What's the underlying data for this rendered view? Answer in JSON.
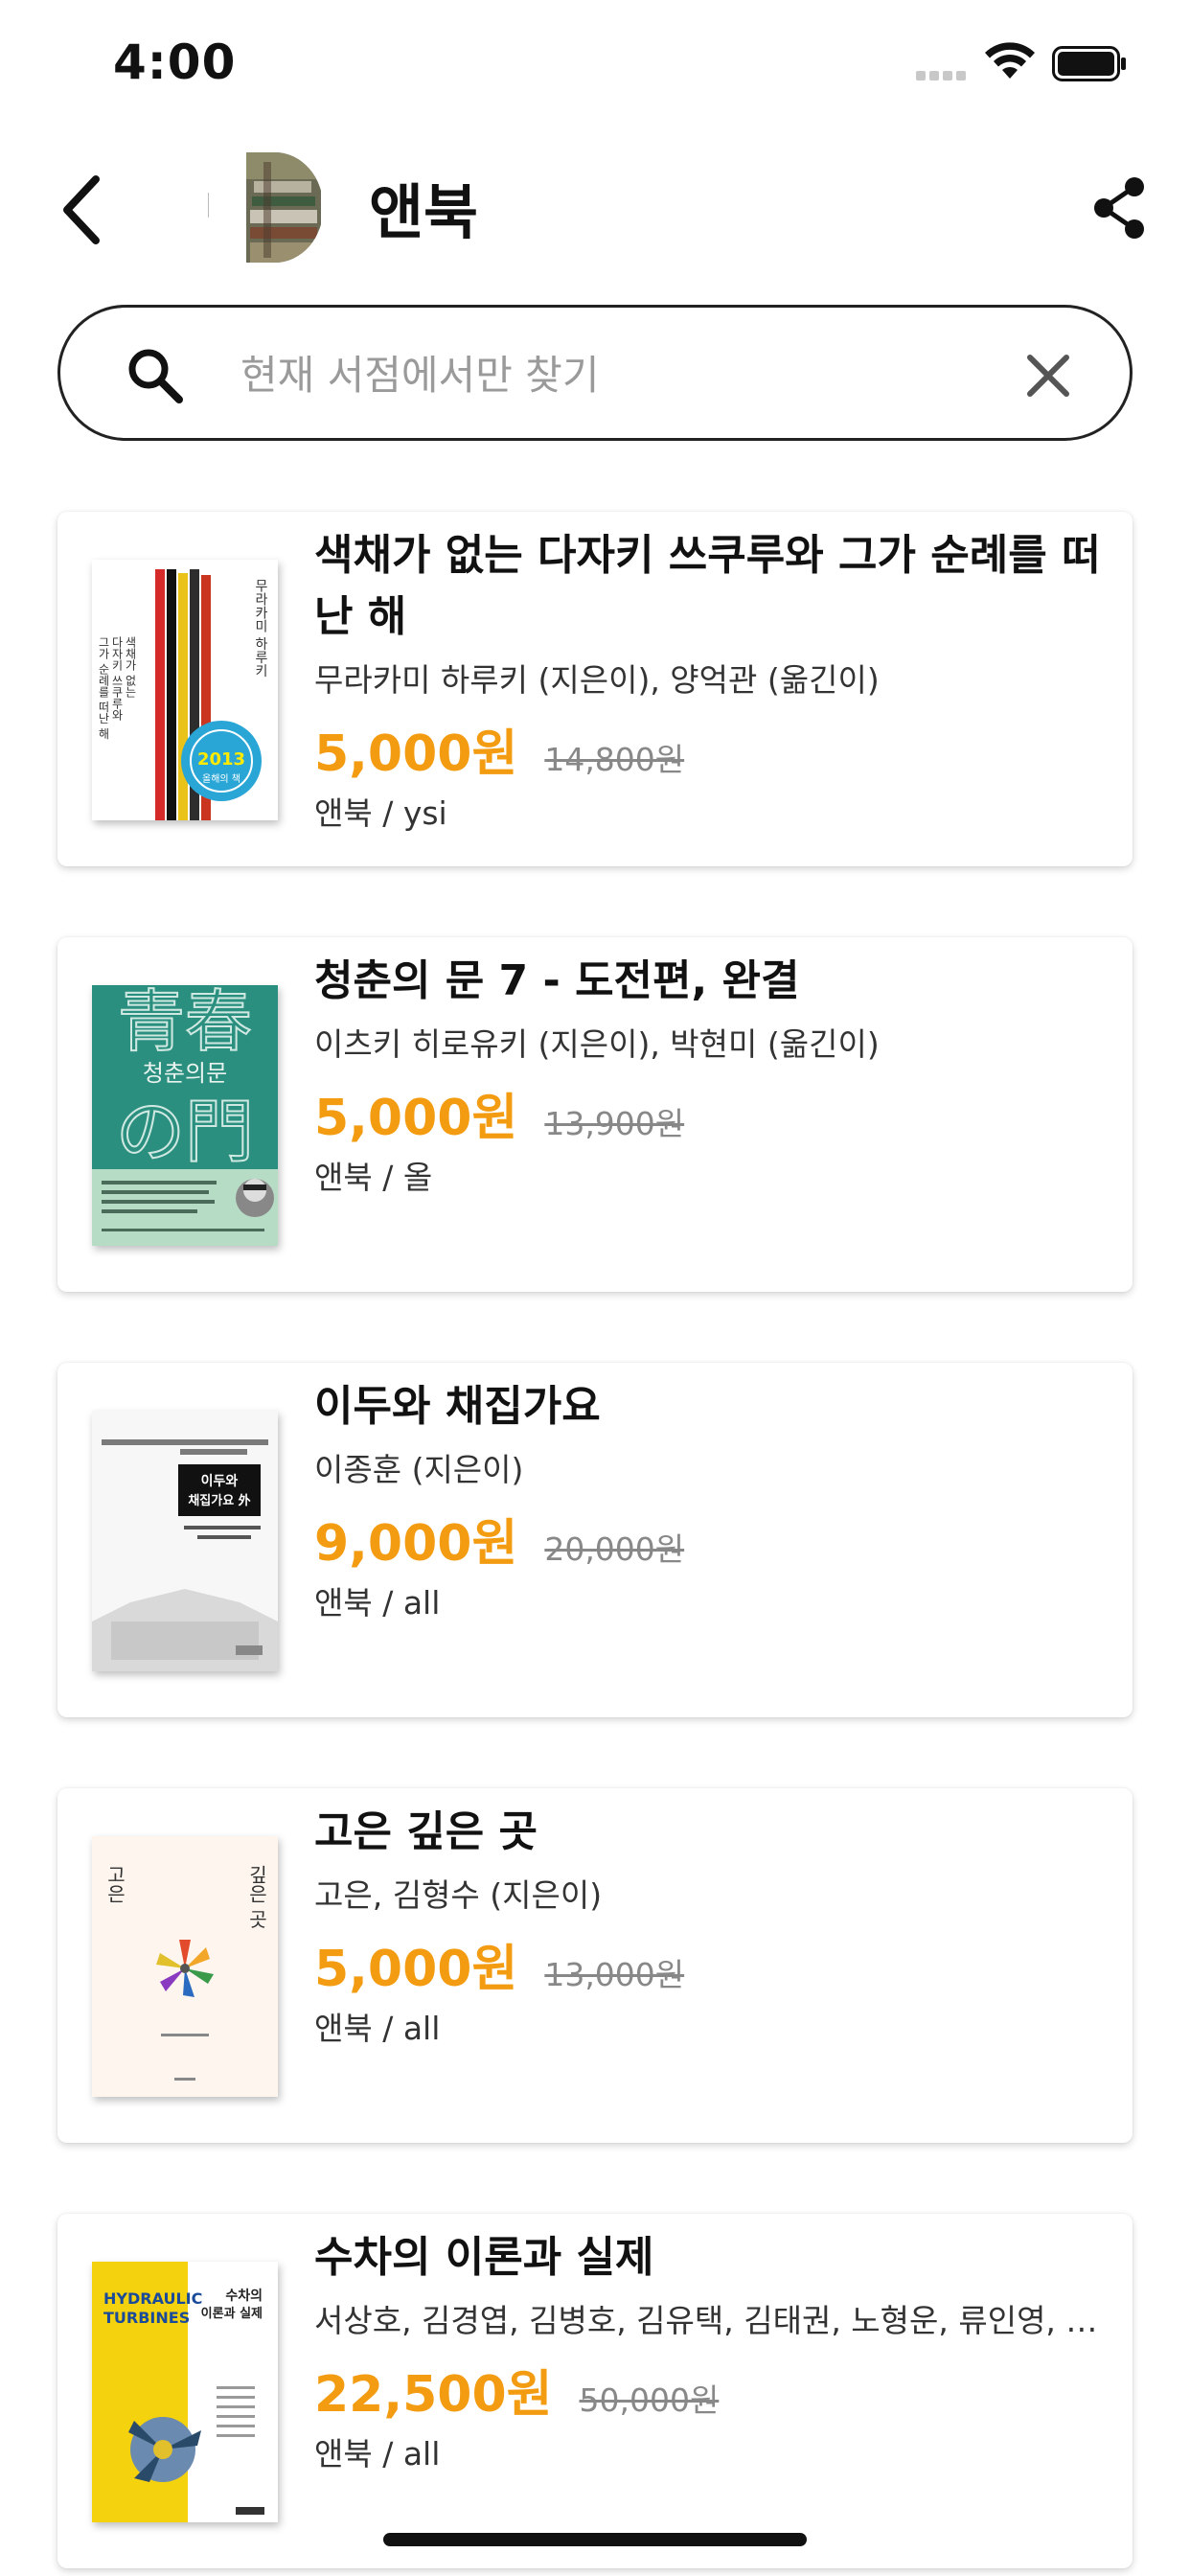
{
  "status_bar": {
    "time": "4:00"
  },
  "header": {
    "store_name": "앤북",
    "back_icon": "chevron-left-icon",
    "share_icon": "share-icon"
  },
  "search": {
    "placeholder": "현재 서점에서만 찾기",
    "value": "",
    "icon": "search-icon",
    "clear_icon": "close-icon"
  },
  "colors": {
    "price": "#f39c12",
    "text": "#111111",
    "muted": "#888888"
  },
  "books": [
    {
      "title": "색채가 없는 다자키 쓰쿠루와 그가 순례를 떠난 해",
      "author": "무라카미 하루키 (지은이), 양억관 (옮긴이)",
      "price": "5,000원",
      "original_price": "14,800원",
      "seller": "앤북 / ysi",
      "cover": {
        "badge_text": "2013",
        "badge_sub": "올해의 책"
      }
    },
    {
      "title": "청춘의 문 7 - 도전편, 완결",
      "author": "이츠키 히로유키 (지은이), 박현미 (옮긴이)",
      "price": "5,000원",
      "original_price": "13,900원",
      "seller": "앤북 / 올",
      "cover": {
        "big_text": "青春",
        "sub_text": "청춘의문",
        "bottom_text": "の門"
      }
    },
    {
      "title": "이두와 채집가요",
      "author": "이종훈 (지은이)",
      "price": "9,000원",
      "original_price": "20,000원",
      "seller": "앤북 / all",
      "cover": {
        "label_1": "이두와",
        "label_2": "채집가요 外"
      }
    },
    {
      "title": "고은 깊은 곳",
      "author": "고은, 김형수 (지은이)",
      "price": "5,000원",
      "original_price": "13,000원",
      "seller": "앤북 / all",
      "cover": {
        "left_text": "고은",
        "right_text": "깊은 곳"
      }
    },
    {
      "title": "수차의 이론과 실제",
      "author": "서상호, 김경엽, 김병호, 김유택, 김태권, 노형운, 류인영, 박상진",
      "price": "22,500원",
      "original_price": "50,000원",
      "seller": "앤북 / all",
      "cover": {
        "en_title": "HYDRAULIC TURBINES",
        "ko_title": "수차의 이론과 실제"
      }
    }
  ]
}
